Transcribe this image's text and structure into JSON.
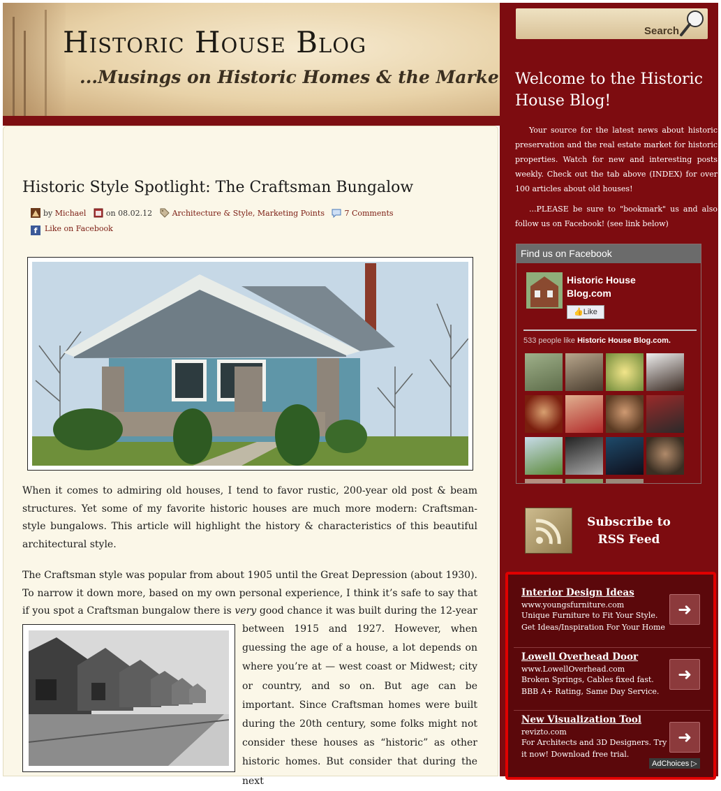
{
  "header": {
    "title": "Historic House Blog",
    "tagline": "...Musings on Historic Homes & the Market"
  },
  "search": {
    "label": "Search"
  },
  "post": {
    "title": "Historic Style Spotlight: The Craftsman Bungalow",
    "meta": {
      "by_prefix": "by",
      "author": "Michael",
      "date_prefix": "on",
      "date": "08.02.12",
      "categories": "Architecture & Style, Marketing Points",
      "comments": "7 Comments",
      "like": "Like on Facebook"
    },
    "para1": "When it comes to admiring old houses, I tend to favor rustic, 200-year old post & beam structures.  Yet some of my favorite historic houses are much more modern:  Craftsman-style bungalows.  This article will highlight the history & characteristics of this beautiful architectural style.",
    "para2_a": "The Craftsman style was popular from about 1905 until the Great Depression (about 1930).  To narrow it down more, based on my own personal experience, I think it’s safe to say that if you spot a Craftsman bungalow there is ",
    "para2_em": "very",
    "para2_b": " good chance it was built during the 12-year period",
    "para3": "between 1915 and 1927.  However, when guessing the age of a house, a lot depends on where you’re at — west coast or Midwest; city or country, and so on.  But age can be important.  Since Craftsman homes were built during the 20th century, some folks might not consider these houses as “historic” as other historic homes.  But consider that during the next"
  },
  "sidebar": {
    "welcome_title": "Welcome to the Historic House Blog!",
    "welcome_p1": "Your source for the latest news about historic preservation and the real estate market for historic properties. Watch for new and interesting posts weekly. Check out the tab above (INDEX) for over 100 articles about old houses!",
    "welcome_p2": "...PLEASE be sure to \"bookmark\" us and also follow us on Facebook! (see link below)",
    "facebook": {
      "header": "Find us on Facebook",
      "page_name": "Historic House Blog.com",
      "like_button": "Like",
      "count_prefix": "533 people like",
      "count_name": "Historic House Blog.com."
    },
    "rss": {
      "label": "Subscribe to RSS Feed"
    }
  },
  "ads": [
    {
      "title": "Interior Design Ideas",
      "url": "www.youngsfurniture.com",
      "desc": "Unique Furniture to Fit Your Style. Get Ideas/Inspiration For Your Home"
    },
    {
      "title": "Lowell Overhead Door",
      "url": "www.LowellOverhead.com",
      "desc": "Broken Springs, Cables fixed fast. BBB A+ Rating, Same Day Service."
    },
    {
      "title": "New Visualization Tool",
      "url": "revizto.com",
      "desc": "For Architects and 3D Designers. Try it now! Download free trial."
    }
  ],
  "adchoices": "AdChoices"
}
